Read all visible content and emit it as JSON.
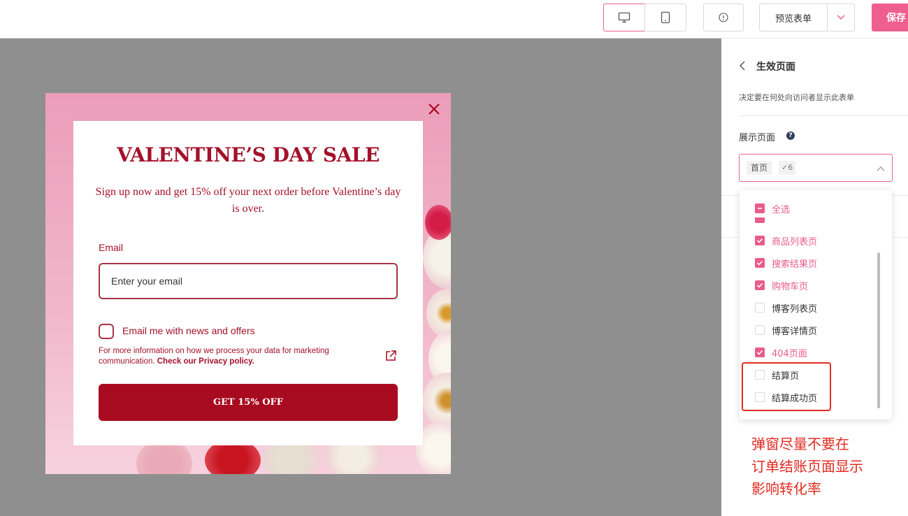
{
  "toolbar": {
    "preview_label": "预览表单",
    "save_label": "保存"
  },
  "popup": {
    "headline": "VALENTINE’S DAY SALE",
    "subtext": "Sign up now and get 15% off your next order  before Valentine’s day is over.",
    "email_label": "Email",
    "email_placeholder": "Enter your email",
    "email_value": "",
    "consent_label": "Email me with news and offers",
    "consent_checked": false,
    "fine_print": "For more information on how we process your data for marketing communication.",
    "privacy_link": "Check our Privacy policy.",
    "cta_label": "GET 15% OFF",
    "colors": {
      "accent": "#a3112a",
      "button": "#a80a1f"
    }
  },
  "panel": {
    "title": "生效页面",
    "description": "决定要在何处向访问者显示此表单",
    "display_label": "展示页面",
    "select": {
      "tag": "首页",
      "count": "✓6"
    },
    "options": [
      {
        "label": "全选",
        "state": "partial"
      },
      {
        "label": "商品列表页",
        "state": "checked"
      },
      {
        "label": "搜索结果页",
        "state": "checked"
      },
      {
        "label": "购物车页",
        "state": "checked"
      },
      {
        "label": "博客列表页",
        "state": "unchecked"
      },
      {
        "label": "博客详情页",
        "state": "unchecked"
      },
      {
        "label": "404页面",
        "state": "checked"
      },
      {
        "label": "结算页",
        "state": "unchecked"
      },
      {
        "label": "结算成功页",
        "state": "unchecked"
      }
    ],
    "colors": {
      "accent": "#ea5b8c"
    }
  },
  "annotation": {
    "lines": [
      "弹窗尽量不要在",
      "订单结账页面显示",
      "影响转化率"
    ],
    "color": "#e12a20"
  }
}
